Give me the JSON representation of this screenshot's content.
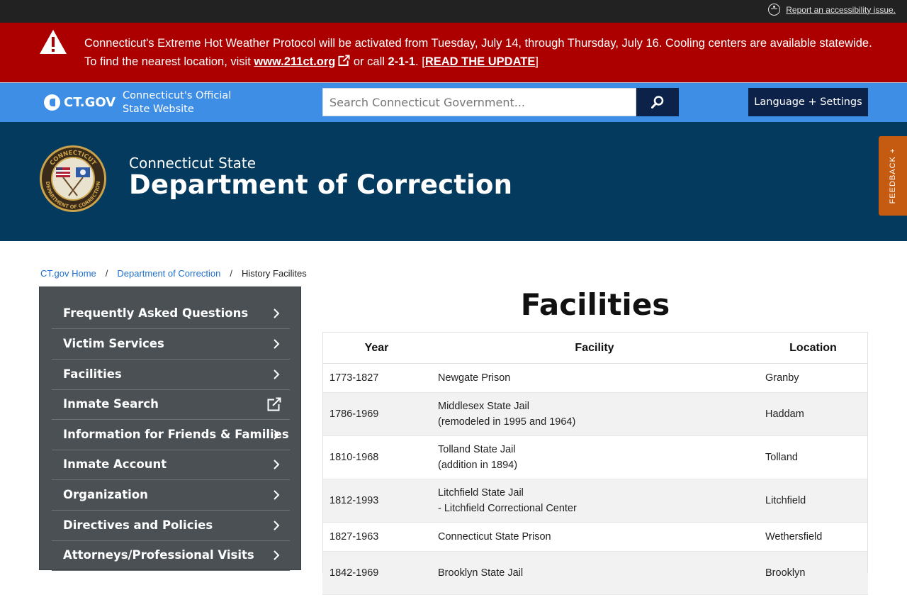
{
  "topbar": {
    "accessibility_link": "Report an accessibility issue."
  },
  "alert": {
    "text_before": "Connecticut's Extreme Hot Weather Protocol will be activated from Tuesday, July 14, through Thursday, July 16. Cooling centers are available statewide. To find the nearest location, visit ",
    "link_text": "www.211ct.org",
    "text_mid": " or call ",
    "phone": "2-1-1",
    "text_after_phone": ". [",
    "update_link": "READ THE UPDATE",
    "text_end": "]"
  },
  "ctbar": {
    "logo_text": "CT.GOV",
    "official_line1": "Connecticut's Official",
    "official_line2": "State Website",
    "search_placeholder": "Search Connecticut Government...",
    "language_button": "Language + Settings"
  },
  "hero": {
    "subtitle": "Connecticut State",
    "title": "Department of Correction",
    "seal_top": "CONNECTICUT",
    "seal_bottom": "DEPARTMENT OF CORRECTION"
  },
  "feedback": {
    "label": "FEEDBACK +"
  },
  "breadcrumb": {
    "home": "CT.gov Home",
    "sep": "/",
    "dept": "Department of Correction",
    "current": "History Facilites"
  },
  "sidenav": {
    "items": [
      {
        "label": "Frequently Asked Questions",
        "icon": "chevron-right-icon"
      },
      {
        "label": "Victim Services",
        "icon": "chevron-right-icon"
      },
      {
        "label": "Facilities",
        "icon": "chevron-right-icon"
      },
      {
        "label": "Inmate Search",
        "icon": "external-link-icon"
      },
      {
        "label": "Information for Friends & Families",
        "icon": "chevron-right-icon"
      },
      {
        "label": "Inmate Account",
        "icon": "chevron-right-icon"
      },
      {
        "label": "Organization",
        "icon": "chevron-right-icon"
      },
      {
        "label": "Directives and Policies",
        "icon": "chevron-right-icon"
      },
      {
        "label": "Attorneys/Professional Visits",
        "icon": "chevron-right-icon"
      }
    ]
  },
  "main": {
    "title": "Facilities",
    "table": {
      "headers": [
        "Year",
        "Facility",
        "Location"
      ],
      "rows": [
        {
          "year": "1773-1827",
          "facility": [
            "Newgate Prison"
          ],
          "location": "Granby"
        },
        {
          "year": "1786-1969",
          "facility": [
            "Middlesex State Jail",
            "(remodeled in 1995 and 1964)"
          ],
          "location": "Haddam"
        },
        {
          "year": "1810-1968",
          "facility": [
            "Tolland State Jail",
            "(addition in 1894)"
          ],
          "location": "Tolland"
        },
        {
          "year": "1812-1993",
          "facility": [
            "Litchfield State Jail",
            "- Litchfield Correctional Center"
          ],
          "location": "Litchfield"
        },
        {
          "year": "1827-1963",
          "facility": [
            "Connecticut State Prison"
          ],
          "location": "Wethersfield"
        },
        {
          "year": "1842-1969",
          "facility": [
            "Brooklyn State Jail"
          ],
          "location": "Brooklyn"
        }
      ]
    }
  }
}
